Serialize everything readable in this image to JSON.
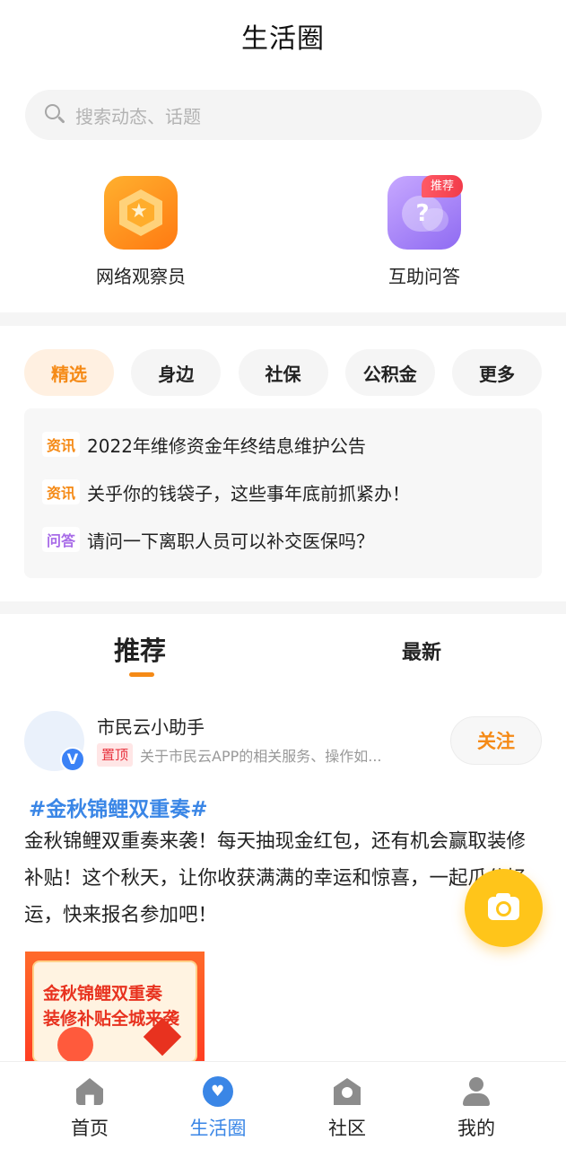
{
  "header": {
    "title": "生活圈"
  },
  "search": {
    "placeholder": "搜索动态、话题"
  },
  "quick_entries": [
    {
      "label": "网络观察员",
      "icon": "shield-star-icon"
    },
    {
      "label": "互助问答",
      "icon": "question-bubble-icon",
      "tag": "推荐"
    }
  ],
  "categories": [
    "精选",
    "身边",
    "社保",
    "公积金",
    "更多"
  ],
  "active_category": "精选",
  "news": [
    {
      "badge": "资讯",
      "text": "2022年维修资金年终结息维护公告"
    },
    {
      "badge": "资讯",
      "text": "关乎你的钱袋子，这些事年底前抓紧办！"
    },
    {
      "badge": "问答",
      "text": "请问一下离职人员可以补交医保吗？"
    }
  ],
  "feed_tabs": {
    "recommend": "推荐",
    "latest": "最新"
  },
  "post": {
    "username": "市民云小助手",
    "verified_mark": "V",
    "pin_badge": "置顶",
    "pin_text": "关于市民云APP的相关服务、操作如...",
    "follow_label": "关注",
    "hashtag": "#金秋锦鲤双重奏#",
    "body": "金秋锦鲤双重奏来袭！每天抽现金红包，还有机会赢取装修补贴！这个秋天，让你收获满满的幸运和惊喜，一起瓜分好运，快来报名参加吧！",
    "image_text_line1": "金秋锦鲤双重奏",
    "image_text_line2": "装修补贴全城来袭"
  },
  "fab": {
    "icon": "camera-icon"
  },
  "tabbar": [
    {
      "label": "首页",
      "icon": "home-icon"
    },
    {
      "label": "生活圈",
      "icon": "heart-circle-icon",
      "active": true
    },
    {
      "label": "社区",
      "icon": "community-icon"
    },
    {
      "label": "我的",
      "icon": "person-icon"
    }
  ],
  "colors": {
    "accent_orange": "#f58a16",
    "accent_blue": "#3a86e6",
    "fab_yellow": "#ffc51a",
    "tag_red": "#f23b4a"
  }
}
